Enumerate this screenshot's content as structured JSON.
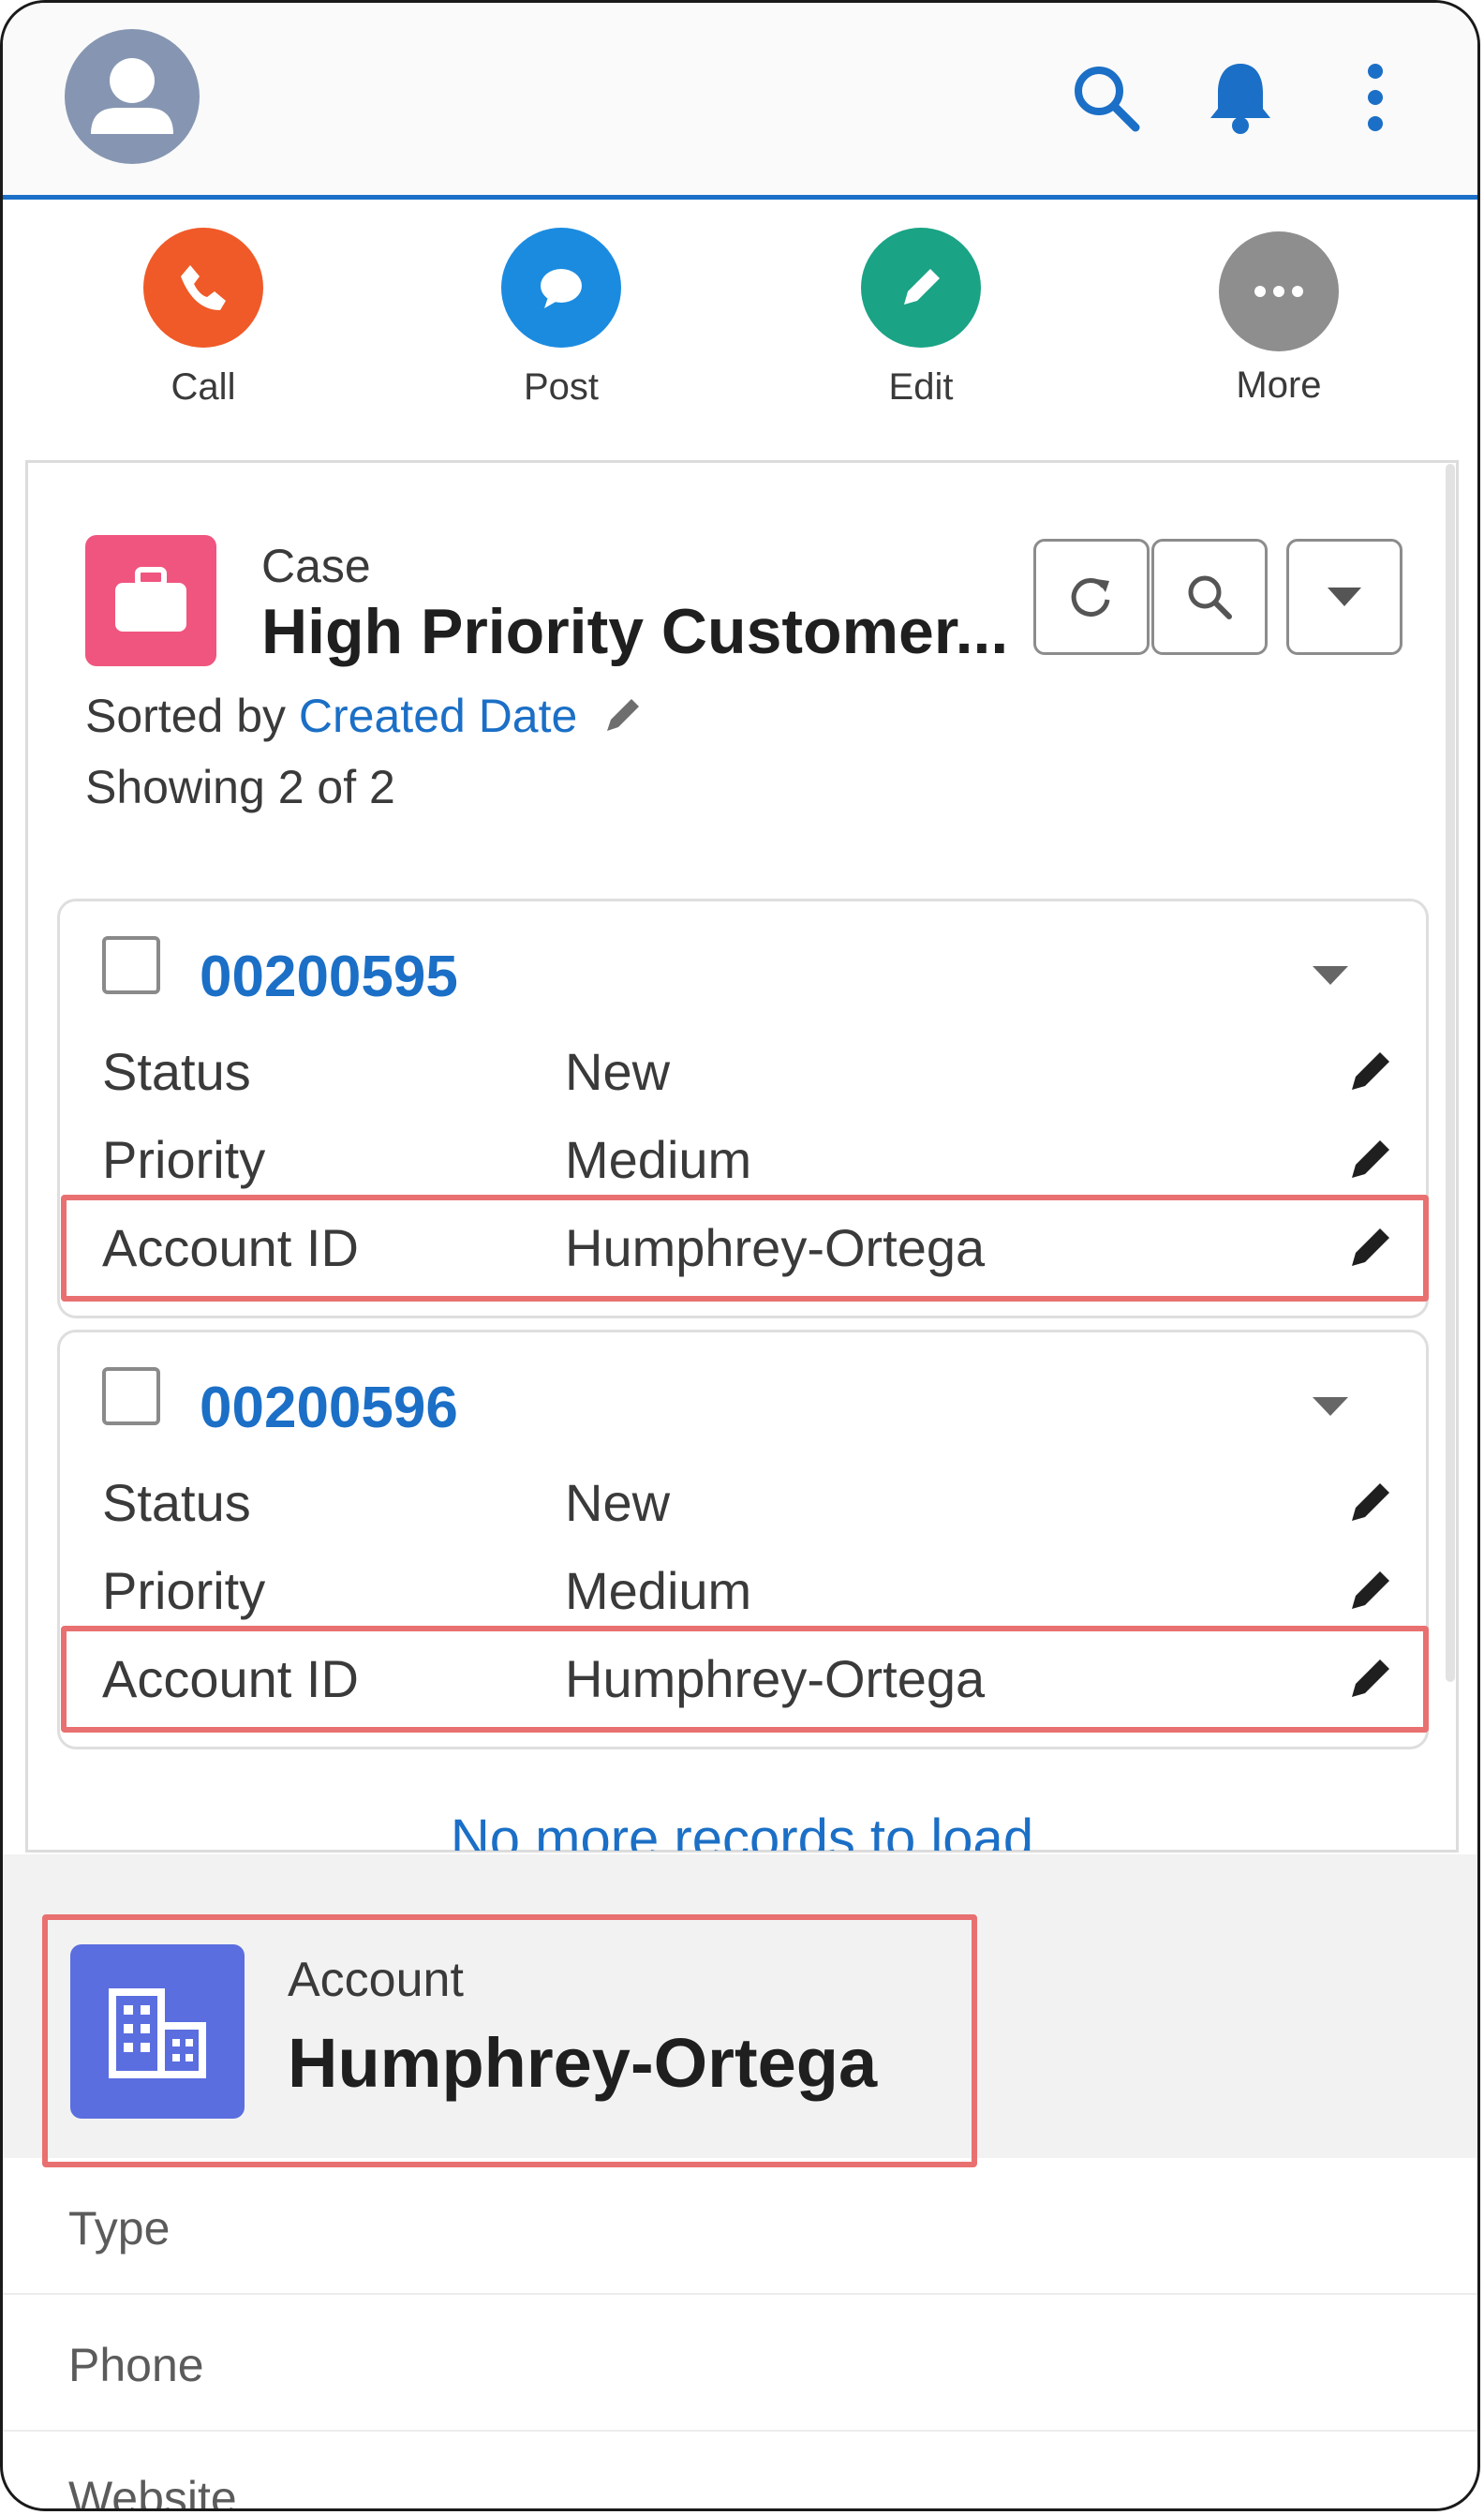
{
  "header": {
    "icons": [
      "avatar-icon",
      "search-icon",
      "bell-icon",
      "more-vertical-icon"
    ]
  },
  "actions": [
    {
      "label": "Call",
      "color": "#f05a28",
      "icon": "phone-icon"
    },
    {
      "label": "Post",
      "color": "#1b8be0",
      "icon": "chat-icon"
    },
    {
      "label": "Edit",
      "color": "#1aa385",
      "icon": "pencil-icon"
    },
    {
      "label": "More",
      "color": "#8e8e8e",
      "icon": "ellipsis-icon"
    }
  ],
  "list": {
    "object_type": "Case",
    "title": "High Priority Customer...",
    "sorted_prefix": "Sorted by",
    "sorted_field": "Created Date",
    "showing": "Showing 2 of 2",
    "no_more": "No more records to load"
  },
  "records": [
    {
      "number": "00200595",
      "fields": [
        {
          "label": "Status",
          "value": "New"
        },
        {
          "label": "Priority",
          "value": "Medium"
        },
        {
          "label": "Account ID",
          "value": "Humphrey-Ortega"
        }
      ]
    },
    {
      "number": "00200596",
      "fields": [
        {
          "label": "Status",
          "value": "New"
        },
        {
          "label": "Priority",
          "value": "Medium"
        },
        {
          "label": "Account ID",
          "value": "Humphrey-Ortega"
        }
      ]
    }
  ],
  "account": {
    "object_type": "Account",
    "name": "Humphrey-Ortega",
    "fields": [
      "Type",
      "Phone",
      "Website"
    ]
  },
  "colors": {
    "accent": "#1b6fc6",
    "highlight": "#e97070",
    "case_icon": "#f0557f",
    "account_icon": "#5a6ee0"
  }
}
